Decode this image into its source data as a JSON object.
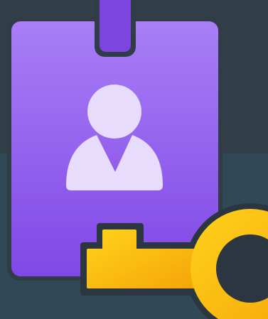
{
  "icon": {
    "name": "id-badge-key-icon",
    "description_free": true
  },
  "colors": {
    "background_top": "#323e48",
    "background_bottom": "#314957",
    "badge_top": "#a97ef6",
    "badge_bottom": "#8048e6",
    "badge_outline": "#303c46",
    "strap": "#7c45dd",
    "avatar": "#e7dcfb",
    "key_light": "#ffd21a",
    "key_dark": "#f5a60a",
    "key_outline": "#2c3640"
  }
}
